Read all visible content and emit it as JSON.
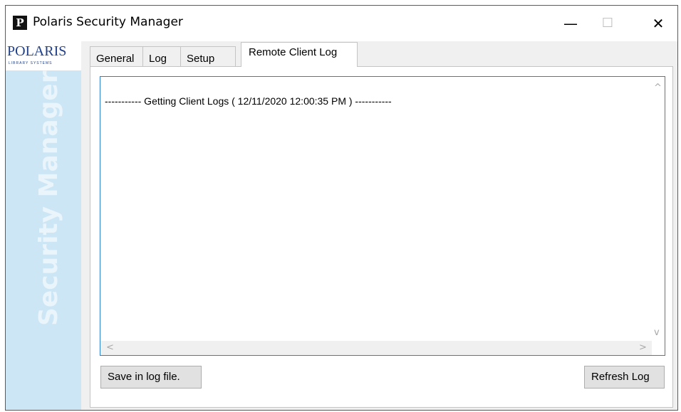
{
  "window": {
    "title": "Polaris Security Manager",
    "app_icon_letter": "P",
    "controls": {
      "minimize": "—",
      "maximize": "☐",
      "close": "✕"
    }
  },
  "sidebar": {
    "logo_text": "POLARIS",
    "logo_subtext": "LIBRARY SYSTEMS",
    "title": "Security Manager"
  },
  "tabs": [
    {
      "label": "General"
    },
    {
      "label": "Log"
    },
    {
      "label": "Setup"
    },
    {
      "label": "Remote Client Log"
    }
  ],
  "active_tab": "Remote Client Log",
  "log": {
    "lines": [
      "----------- Getting Client Logs ( 12/11/2020 12:00:35 PM ) -----------"
    ]
  },
  "scroll_arrows": {
    "up": "^",
    "down": "v",
    "left": "<",
    "right": ">"
  },
  "buttons": {
    "save_label": "Save in log file.",
    "refresh_label": "Refresh Log"
  },
  "colors": {
    "sidebar_bg": "#cde6f6",
    "accent_border": "#2f7fd1",
    "logo_blue": "#1f3f8a"
  }
}
